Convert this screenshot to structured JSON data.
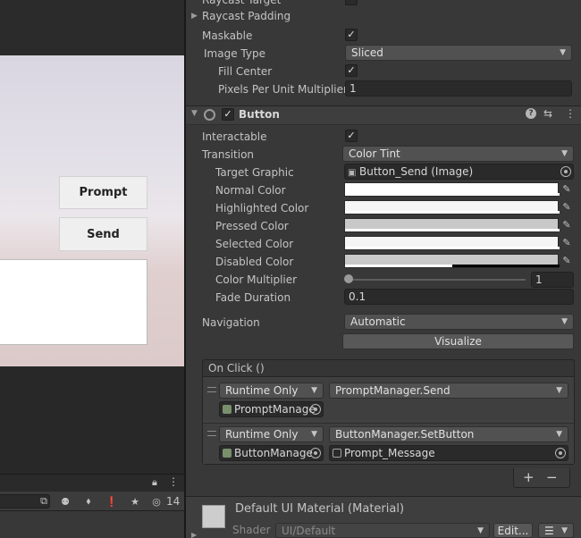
{
  "scene": {
    "prompt_button": "Prompt",
    "send_button": "Send",
    "console_count": "14"
  },
  "inspector": {
    "raycast_target_label": "Raycast Target",
    "raycast_padding_label": "Raycast Padding",
    "maskable_label": "Maskable",
    "image_type_label": "Image Type",
    "image_type_value": "Sliced",
    "fill_center_label": "Fill Center",
    "ppu_label": "Pixels Per Unit Multiplier",
    "ppu_value": "1",
    "component_title": "Button",
    "interactable_label": "Interactable",
    "transition_label": "Transition",
    "transition_value": "Color Tint",
    "target_graphic_label": "Target Graphic",
    "target_graphic_value": "Button_Send (Image)",
    "normal_color_label": "Normal Color",
    "highlighted_color_label": "Highlighted Color",
    "pressed_color_label": "Pressed Color",
    "selected_color_label": "Selected Color",
    "disabled_color_label": "Disabled Color",
    "color_multiplier_label": "Color Multiplier",
    "color_multiplier_value": "1",
    "fade_duration_label": "Fade Duration",
    "fade_duration_value": "0.1",
    "navigation_label": "Navigation",
    "navigation_value": "Automatic",
    "visualize_button": "Visualize",
    "on_click_label": "On Click ()",
    "events": [
      {
        "mode": "Runtime Only",
        "function": "PromptManager.Send",
        "target": "PromptManage",
        "argument": ""
      },
      {
        "mode": "Runtime Only",
        "function": "ButtonManager.SetButton",
        "target": "ButtonManage",
        "argument": "Prompt_Message"
      }
    ],
    "plus_label": "+",
    "minus_label": "−",
    "material_title": "Default UI Material (Material)",
    "shader_label": "Shader",
    "shader_value": "UI/Default",
    "edit_button": "Edit..."
  },
  "colors": {
    "normal": "#ffffff",
    "highlighted": "#f5f5f5",
    "pressed": "#c8c8c8",
    "selected": "#f5f5f5",
    "disabled": "#c8c8c8"
  }
}
